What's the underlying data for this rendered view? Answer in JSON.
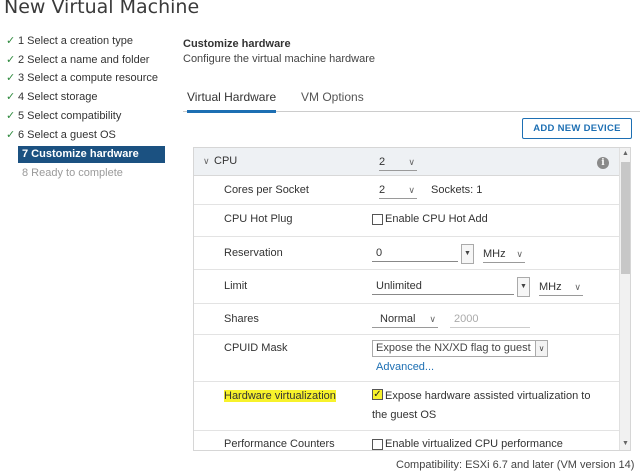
{
  "window": {
    "title": "New Virtual Machine"
  },
  "steps": [
    {
      "label": "1 Select a creation type",
      "state": "done"
    },
    {
      "label": "2 Select a name and folder",
      "state": "done"
    },
    {
      "label": "3 Select a compute resource",
      "state": "done"
    },
    {
      "label": "4 Select storage",
      "state": "done"
    },
    {
      "label": "5 Select compatibility",
      "state": "done"
    },
    {
      "label": "6 Select a guest OS",
      "state": "done"
    },
    {
      "label": "7 Customize hardware",
      "state": "active"
    },
    {
      "label": "8 Ready to complete",
      "state": "disabled"
    }
  ],
  "header": {
    "title": "Customize hardware",
    "subtitle": "Configure the virtual machine hardware"
  },
  "tabs": [
    {
      "label": "Virtual Hardware",
      "active": true
    },
    {
      "label": "VM Options",
      "active": false
    }
  ],
  "add_device_label": "ADD NEW DEVICE",
  "cpu": {
    "label": "CPU",
    "value": "2",
    "cores_per_socket_label": "Cores per Socket",
    "cores_per_socket_value": "2",
    "sockets_text": "Sockets: 1",
    "hot_plug_label": "CPU Hot Plug",
    "hot_plug_checkbox": "Enable CPU Hot Add",
    "hot_plug_checked": false,
    "reservation_label": "Reservation",
    "reservation_value": "0",
    "reservation_unit": "MHz",
    "limit_label": "Limit",
    "limit_value": "Unlimited",
    "limit_unit": "MHz",
    "shares_label": "Shares",
    "shares_level": "Normal",
    "shares_value": "2000",
    "cpuid_label": "CPUID Mask",
    "cpuid_value": "Expose the NX/XD flag to guest",
    "advanced_link": "Advanced...",
    "hv_label": "Hardware virtualization",
    "hv_text_line1": "Expose hardware assisted virtualization to",
    "hv_text_line2": "the guest OS",
    "hv_checked": true,
    "perf_label": "Performance Counters",
    "perf_text": "Enable virtualized CPU performance"
  },
  "footer": {
    "compatibility": "Compatibility: ESXi 6.7 and later (VM version 14)"
  },
  "colors": {
    "accent": "#1d6fb3",
    "active_step": "#1b5181",
    "check": "#2f8a3e",
    "highlight": "#f7f22b"
  }
}
